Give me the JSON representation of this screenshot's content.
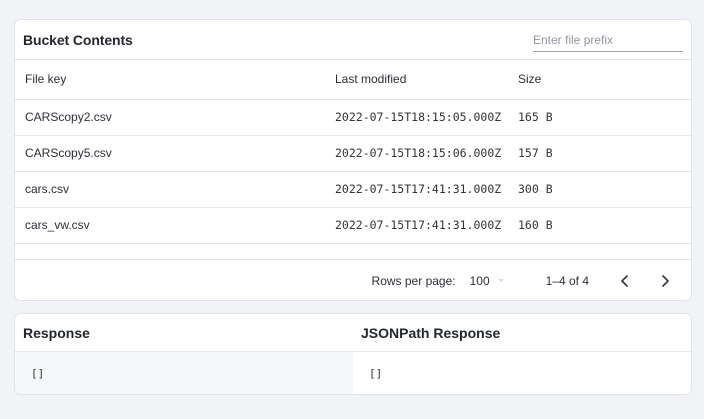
{
  "bucket": {
    "title": "Bucket Contents",
    "prefix_placeholder": "Enter file prefix",
    "prefix_value": "",
    "columns": {
      "key": "File key",
      "modified": "Last modified",
      "size": "Size"
    },
    "rows": [
      {
        "key": "CARScopy2.csv",
        "modified": "2022-07-15T18:15:05.000Z",
        "size": "165 B"
      },
      {
        "key": "CARScopy5.csv",
        "modified": "2022-07-15T18:15:06.000Z",
        "size": "157 B"
      },
      {
        "key": "cars.csv",
        "modified": "2022-07-15T17:41:31.000Z",
        "size": "300 B"
      },
      {
        "key": "cars_vw.csv",
        "modified": "2022-07-15T17:41:31.000Z",
        "size": "160 B"
      }
    ],
    "pagination": {
      "rows_per_page_label": "Rows per page:",
      "rows_per_page_value": "100",
      "range": "1–4 of 4"
    }
  },
  "response": {
    "title": "Response",
    "value": "[]",
    "jsonpath_title": "JSONPath Response",
    "jsonpath_value": "[]"
  },
  "icons": {
    "prev": "chevron-left-icon",
    "next": "chevron-right-icon",
    "rows_per_page_dropdown": "caret-down-icon"
  }
}
